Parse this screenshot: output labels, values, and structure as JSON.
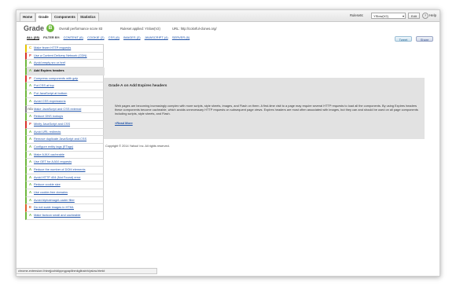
{
  "tabs": [
    "Home",
    "Grade",
    "Components",
    "Statistics"
  ],
  "toolbar": {
    "ruleset_label": "Rulesets:",
    "ruleset_value": "YSlow(V2)",
    "edit_label": "Edit",
    "help_label": "Help"
  },
  "header": {
    "grade_label": "Grade",
    "grade_value": "B",
    "score_text": "Overall performance score 83",
    "ruleset_text": "Ruleset applied: YSlow(V2)",
    "url_text": "URL: http://colorful-clones.org/"
  },
  "filters": {
    "all": "ALL (23)",
    "label": "FILTER BY:",
    "links": [
      "CONTENT (6)",
      "COOKIE (2)",
      "CSS (6)",
      "IMAGES (2)",
      "JAVASCRIPT (4)",
      "SERVER (6)"
    ]
  },
  "social": {
    "tweet": "Tweet",
    "share": "Share"
  },
  "colors": {
    "grade_a": "#6fb83d",
    "grade_b": "#a6cf3f",
    "grade_c": "#e8c500",
    "grade_f": "#d9332b",
    "grade_e": "#e0602a",
    "grade_na": "#808080",
    "link": "#2255aa",
    "panel_bg": "#e2e2e2"
  },
  "rules": [
    {
      "grade": "C",
      "label": "Make fewer HTTP requests",
      "color": "#e8c500"
    },
    {
      "grade": "F",
      "label": "Use a Content Delivery Network (CDN)",
      "color": "#d9332b"
    },
    {
      "grade": "A",
      "label": "Avoid empty src or href",
      "color": "#6fb83d"
    },
    {
      "grade": "A",
      "label": "Add Expires headers",
      "color": "#6fb83d",
      "selected": true
    },
    {
      "grade": "F",
      "label": "Compress components with gzip",
      "color": "#d9332b"
    },
    {
      "grade": "A",
      "label": "Put CSS at top",
      "color": "#6fb83d"
    },
    {
      "grade": "A",
      "label": "Put JavaScript at bottom",
      "color": "#6fb83d"
    },
    {
      "grade": "A",
      "label": "Avoid CSS expressions",
      "color": "#6fb83d"
    },
    {
      "grade": "n/a",
      "label": "Make JavaScript and CSS external",
      "color": "#808080"
    },
    {
      "grade": "A",
      "label": "Reduce DNS lookups",
      "color": "#6fb83d"
    },
    {
      "grade": "F",
      "label": "Minify JavaScript and CSS",
      "color": "#d9332b"
    },
    {
      "grade": "A",
      "label": "Avoid URL redirects",
      "color": "#6fb83d"
    },
    {
      "grade": "A",
      "label": "Remove duplicate JavaScript and CSS",
      "color": "#6fb83d"
    },
    {
      "grade": "A",
      "label": "Configure entity tags (ETags)",
      "color": "#6fb83d"
    },
    {
      "grade": "A",
      "label": "Make AJAX cacheable",
      "color": "#6fb83d"
    },
    {
      "grade": "A",
      "label": "Use GET for AJAX requests",
      "color": "#6fb83d"
    },
    {
      "grade": "A",
      "label": "Reduce the number of DOM elements",
      "color": "#6fb83d"
    },
    {
      "grade": "A",
      "label": "Avoid HTTP 404 (Not Found) error",
      "color": "#6fb83d"
    },
    {
      "grade": "A",
      "label": "Reduce cookie size",
      "color": "#6fb83d"
    },
    {
      "grade": "A",
      "label": "Use cookie-free domains",
      "color": "#6fb83d"
    },
    {
      "grade": "A",
      "label": "Avoid AlphaImageLoader filter",
      "color": "#6fb83d"
    },
    {
      "grade": "E",
      "label": "Do not scale images in HTML",
      "color": "#e0602a"
    },
    {
      "grade": "A",
      "label": "Make favicon small and cacheable",
      "color": "#6fb83d"
    }
  ],
  "detail": {
    "title": "Grade A on Add Expires headers",
    "body": "Web pages are becoming increasingly complex with more scripts, style sheets, images, and Flash on them. A first-time visit to a page may require several HTTP requests to load all the components. By using Expires headers these components become cacheable, which avoids unnecessary HTTP requests on subsequent page views. Expires headers are most often associated with images, but they can and should be used on all page components including scripts, style sheets, and Flash.",
    "read_more": "»Read More"
  },
  "copyright": "Copyright © 2014 Yahoo! Inc. All rights reserved.",
  "status_url": "chrome-extension://ninejjcohidippngpapiilnmkgllnainh/yslow.html#"
}
